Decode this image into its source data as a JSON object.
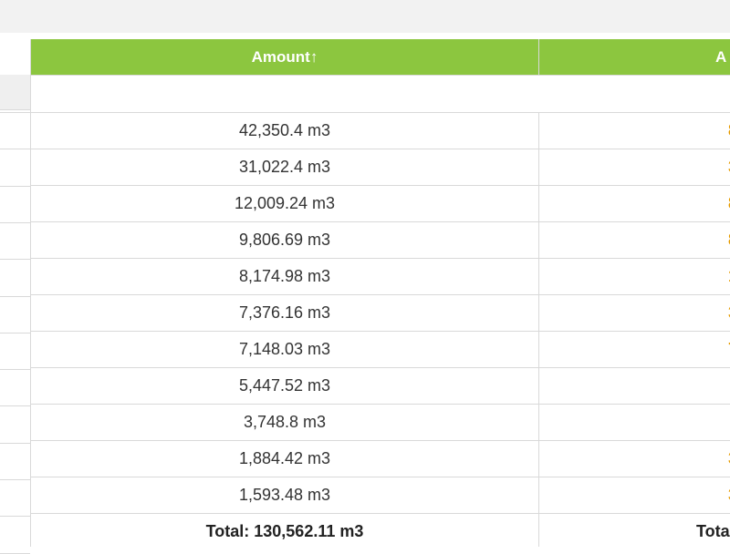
{
  "header": {
    "amount_label": "Amount↑",
    "second_label": "A"
  },
  "rows": [
    {
      "amount": "42,350.4 m3",
      "second": "8"
    },
    {
      "amount": "31,022.4 m3",
      "second": "3"
    },
    {
      "amount": "12,009.24 m3",
      "second": "8"
    },
    {
      "amount": "9,806.69 m3",
      "second": "8"
    },
    {
      "amount": "8,174.98 m3",
      "second": "1"
    },
    {
      "amount": "7,376.16 m3",
      "second": "3"
    },
    {
      "amount": "7,148.03 m3",
      "second": "7"
    },
    {
      "amount": "5,447.52 m3",
      "second": ""
    },
    {
      "amount": "3,748.8 m3",
      "second": ""
    },
    {
      "amount": "1,884.42 m3",
      "second": "3"
    },
    {
      "amount": "1,593.48 m3",
      "second": "3"
    }
  ],
  "totals": {
    "amount": "Total: 130,562.11 m3",
    "second": "Tota"
  },
  "colors": {
    "header_bg": "#8cc63f",
    "header_text": "#ffffff",
    "accent_value": "#e69b00",
    "grid_line": "#d9d9d9",
    "top_bar": "#f2f2f2"
  }
}
